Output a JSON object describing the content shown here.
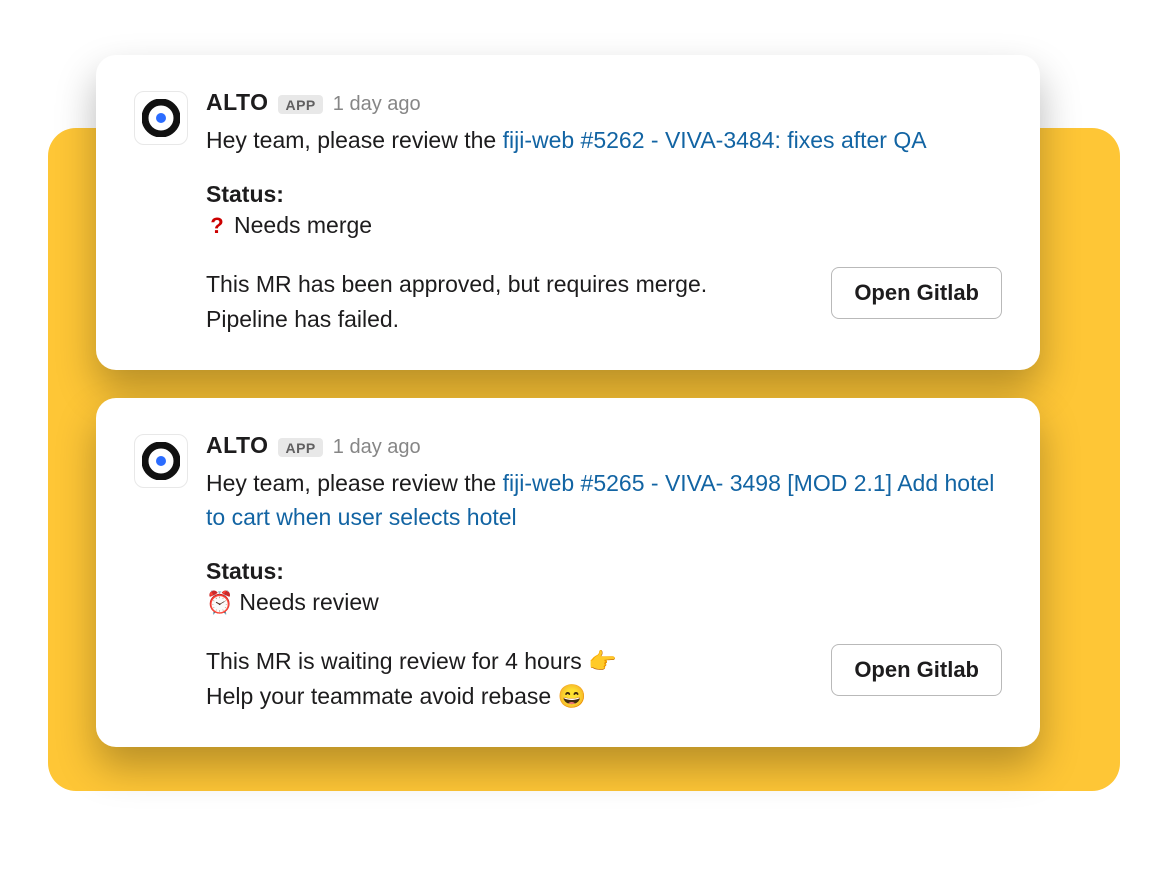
{
  "colors": {
    "accent_yellow": "#FEC636",
    "link": "#1264a3"
  },
  "messages": [
    {
      "bot_name": "ALTO",
      "app_badge": "APP",
      "timestamp": "1 day ago",
      "intro_prefix": "Hey team, please review the ",
      "link_text": "fiji-web #5262 - VIVA-3484: fixes after QA",
      "status_label": "Status:",
      "status_icon_name": "question-mark-icon",
      "status_icon_glyph": "?",
      "status_text": "Needs merge",
      "detail_line1": "This MR has been approved, but requires merge.",
      "detail_line2": "Pipeline has failed.",
      "button_label": "Open Gitlab"
    },
    {
      "bot_name": "ALTO",
      "app_badge": "APP",
      "timestamp": "1 day ago",
      "intro_prefix": "Hey team, please review the ",
      "link_text": "fiji-web #5265 - VIVA- 3498 [MOD 2.1] Add hotel to cart when user selects hotel",
      "status_label": "Status:",
      "status_icon_name": "alarm-clock-icon",
      "status_icon_glyph": "⏰",
      "status_text": "Needs review",
      "detail_line1": "This MR is waiting review for 4 hours 👉",
      "detail_line2": "Help your teammate avoid rebase 😄",
      "button_label": "Open Gitlab"
    }
  ]
}
